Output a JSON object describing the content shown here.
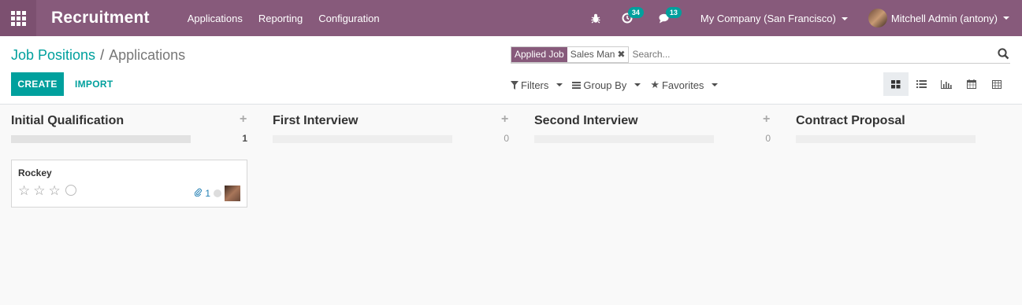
{
  "navbar": {
    "app_title": "Recruitment",
    "menu": [
      "Applications",
      "Reporting",
      "Configuration"
    ],
    "activity_badge": "34",
    "messages_badge": "13",
    "company": "My Company (San Francisco)",
    "user": "Mitchell Admin (antony)",
    "color": "#875a7b"
  },
  "breadcrumb": {
    "parent": "Job Positions",
    "separator": "/",
    "current": "Applications"
  },
  "buttons": {
    "create": "CREATE",
    "import": "IMPORT"
  },
  "search": {
    "facet_category": "Applied Job",
    "facet_value": "Sales Man",
    "placeholder": "Search..."
  },
  "filters": {
    "filters": "Filters",
    "group_by": "Group By",
    "favorites": "Favorites"
  },
  "views": [
    "kanban-icon",
    "list-icon",
    "graph-icon",
    "calendar-icon",
    "pivot-icon"
  ],
  "columns": [
    {
      "title": "Initial Qualification",
      "count": "1"
    },
    {
      "title": "First Interview",
      "count": "0"
    },
    {
      "title": "Second Interview",
      "count": "0"
    },
    {
      "title": "Contract Proposal",
      "count": ""
    }
  ],
  "card": {
    "name": "Rockey",
    "attachments": "1"
  },
  "accent": "#00a09d"
}
